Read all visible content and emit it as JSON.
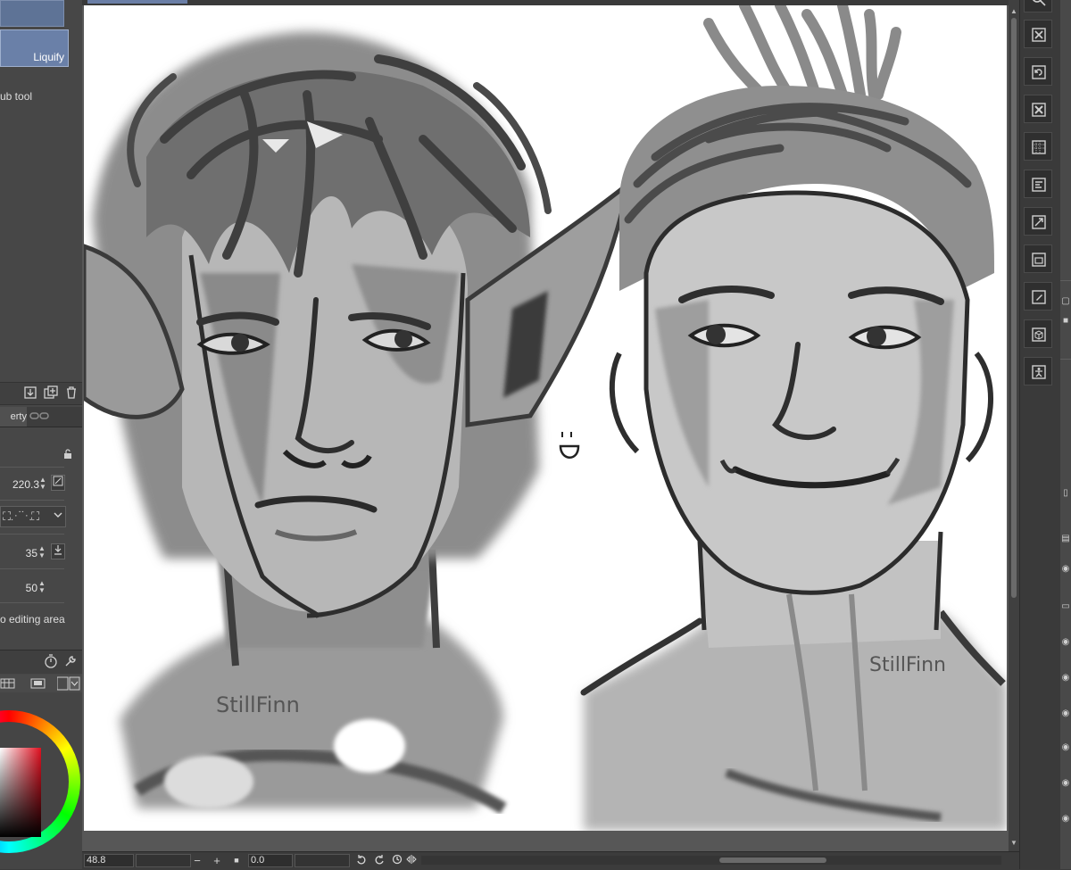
{
  "tool_panel": {
    "selected_tool": "Liquify",
    "subtool_text": "ub tool",
    "property_tab": "erty",
    "brush_size": "220.3",
    "strength": "35",
    "hardness": "50",
    "editing_option": "o editing area"
  },
  "status_bar": {
    "zoom": "48.8",
    "rotation": "0.0"
  },
  "canvas": {
    "signature_left": "StillFinn",
    "signature_right": "StillFinn"
  },
  "colors": {
    "accent": "#6a80a8",
    "panel_bg": "#474747",
    "canvas_bg": "#575757"
  },
  "icons": {
    "layer_toolbar": [
      "import-icon",
      "new-layer-icon",
      "delete-icon"
    ],
    "command_bar": [
      "clear-icon",
      "rotate-icon",
      "delete-icon",
      "grid-icon",
      "layer-property-icon",
      "transform-icon",
      "layer-panel-icon",
      "edit-icon",
      "3d-icon",
      "accessibility-icon"
    ]
  }
}
